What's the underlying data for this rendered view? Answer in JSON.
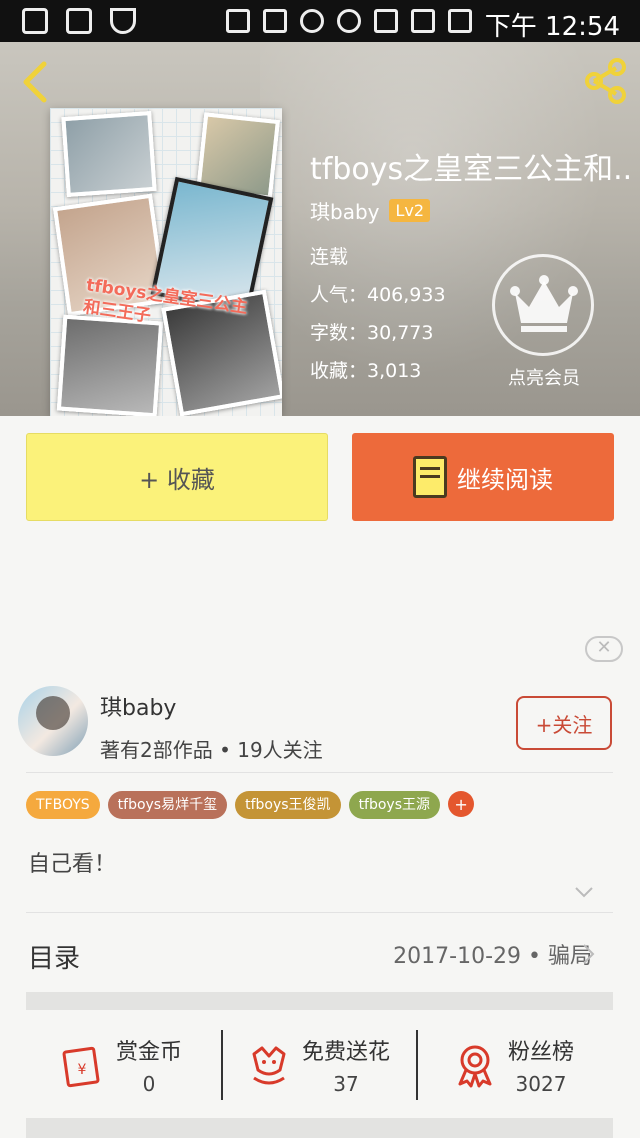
{
  "status_bar": {
    "time": "下午 12:54"
  },
  "book": {
    "title": "tfboys之皇室三公主和...",
    "cover_text": "tfboys之皇室三公主和三王子",
    "author": "琪baby",
    "level": "Lv2",
    "status": "连载",
    "popularity": "人气：406,933",
    "word_count": "字数：30,773",
    "favorites": "收藏：3,013",
    "vip_label": "点亮会员"
  },
  "buttons": {
    "collect": "+ 收藏",
    "continue_reading": "继续阅读"
  },
  "close_label": "✕",
  "author_card": {
    "name": "琪baby",
    "subtitle": "著有2部作品 • 19人关注",
    "follow": "+关注"
  },
  "tags": [
    {
      "label": "TFBOYS",
      "color": "#f5a93e"
    },
    {
      "label": "tfboys易烊千玺",
      "color": "#b9715a"
    },
    {
      "label": "tfboys王俊凯",
      "color": "#c49436"
    },
    {
      "label": "tfboys王源",
      "color": "#8ea74e"
    }
  ],
  "tag_more": "+",
  "description": "自己看！",
  "toc": {
    "label": "目录",
    "latest": "2017-10-29 • 骗局"
  },
  "actions": [
    {
      "label": "赏金币",
      "value": "0"
    },
    {
      "label": "免费送花",
      "value": "37"
    },
    {
      "label": "粉丝榜",
      "value": "3027"
    }
  ],
  "colors": {
    "accent_orange": "#ed6a3b",
    "collect_yellow": "#fbf27a",
    "follow_red": "#c94a36",
    "icon_red": "#d83a2a"
  }
}
